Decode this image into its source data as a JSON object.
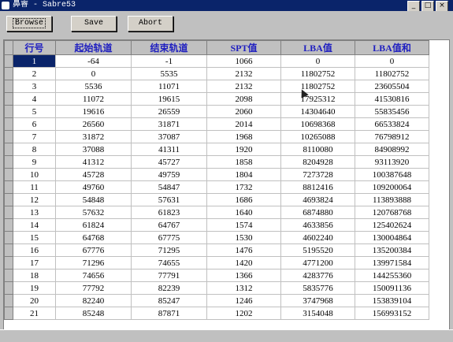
{
  "window": {
    "title": "鼻睿 - Sabre53"
  },
  "toolbar": {
    "browse_label": "Browse",
    "save_label": "Save",
    "abort_label": "Abort"
  },
  "table": {
    "columns": [
      "行号",
      "起始轨道",
      "结束轨道",
      "SPT值",
      "LBA值",
      "LBA值和"
    ],
    "rows": [
      [
        "1",
        "-64",
        "-1",
        "1066",
        "0",
        "0"
      ],
      [
        "2",
        "0",
        "5535",
        "2132",
        "11802752",
        "11802752"
      ],
      [
        "3",
        "5536",
        "11071",
        "2132",
        "11802752",
        "23605504"
      ],
      [
        "4",
        "11072",
        "19615",
        "2098",
        "17925312",
        "41530816"
      ],
      [
        "5",
        "19616",
        "26559",
        "2060",
        "14304640",
        "55835456"
      ],
      [
        "6",
        "26560",
        "31871",
        "2014",
        "10698368",
        "66533824"
      ],
      [
        "7",
        "31872",
        "37087",
        "1968",
        "10265088",
        "76798912"
      ],
      [
        "8",
        "37088",
        "41311",
        "1920",
        "8110080",
        "84908992"
      ],
      [
        "9",
        "41312",
        "45727",
        "1858",
        "8204928",
        "93113920"
      ],
      [
        "10",
        "45728",
        "49759",
        "1804",
        "7273728",
        "100387648"
      ],
      [
        "11",
        "49760",
        "54847",
        "1732",
        "8812416",
        "109200064"
      ],
      [
        "12",
        "54848",
        "57631",
        "1686",
        "4693824",
        "113893888"
      ],
      [
        "13",
        "57632",
        "61823",
        "1640",
        "6874880",
        "120768768"
      ],
      [
        "14",
        "61824",
        "64767",
        "1574",
        "4633856",
        "125402624"
      ],
      [
        "15",
        "64768",
        "67775",
        "1530",
        "4602240",
        "130004864"
      ],
      [
        "16",
        "67776",
        "71295",
        "1476",
        "5195520",
        "135200384"
      ],
      [
        "17",
        "71296",
        "74655",
        "1420",
        "4771200",
        "139971584"
      ],
      [
        "18",
        "74656",
        "77791",
        "1366",
        "4283776",
        "144255360"
      ],
      [
        "19",
        "77792",
        "82239",
        "1312",
        "5835776",
        "150091136"
      ],
      [
        "20",
        "82240",
        "85247",
        "1246",
        "3747968",
        "153839104"
      ],
      [
        "21",
        "85248",
        "87871",
        "1202",
        "3154048",
        "156993152"
      ]
    ]
  }
}
